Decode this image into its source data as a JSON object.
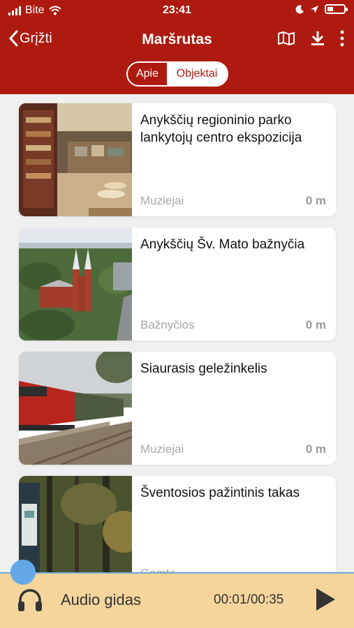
{
  "status": {
    "carrier": "Bite",
    "time": "23:41"
  },
  "header": {
    "back_label": "Grįžti",
    "title": "Maršrutas",
    "tabs": [
      {
        "label": "Apie",
        "selected": false
      },
      {
        "label": "Objektai",
        "selected": true
      }
    ],
    "icons": [
      "map-icon",
      "download-icon",
      "more-vertical-icon"
    ]
  },
  "items": [
    {
      "title": "Anykščių regioninio parko lankytojų centro ekspozicija",
      "category": "Muziejai",
      "distance": "0 m"
    },
    {
      "title": "Anykščių Šv. Mato bažnyčia",
      "category": "Bažnyčios",
      "distance": "0 m"
    },
    {
      "title": "Siaurasis geležinkelis",
      "category": "Muziejai",
      "distance": "0 m"
    },
    {
      "title": "Šventosios pažintinis takas",
      "category": "Gamta",
      "distance": ""
    }
  ],
  "audio": {
    "label": "Audio gidas",
    "time": "00:01/00:35",
    "progress": 0.03
  },
  "colors": {
    "brand": "#ae1a10",
    "audio_bar": "#f5d59c",
    "knob": "#62a8e5"
  }
}
